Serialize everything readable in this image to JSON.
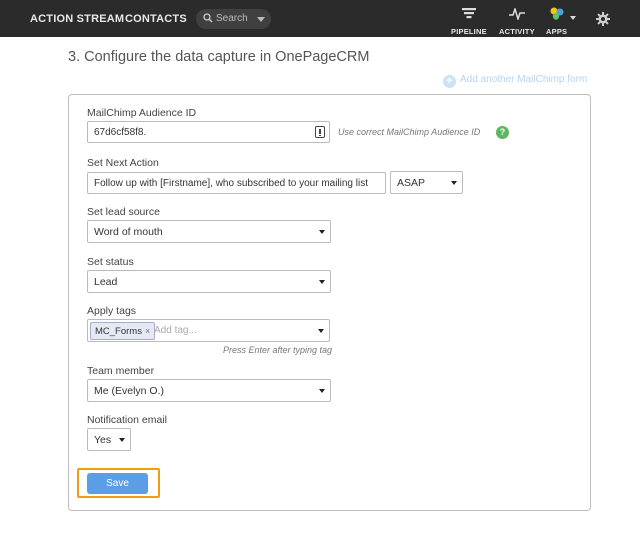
{
  "nav": {
    "action_stream": "ACTION STREAM",
    "contacts": "CONTACTS",
    "search_placeholder": "Search",
    "pipeline": "PIPELINE",
    "activity": "ACTIVITY",
    "apps": "APPS"
  },
  "page": {
    "heading": "3. Configure the data capture in OnePageCRM",
    "add_form_link": "Add another MailChimp form"
  },
  "form": {
    "audience_id": {
      "label": "MailChimp Audience ID",
      "value": "67d6cf58f8.",
      "hint": "Use correct MailChimp Audience ID"
    },
    "next_action": {
      "label": "Set Next Action",
      "value": "Follow up with [Firstname], who subscribed to your mailing list",
      "timing": "ASAP"
    },
    "lead_source": {
      "label": "Set lead source",
      "value": "Word of mouth"
    },
    "status": {
      "label": "Set status",
      "value": "Lead"
    },
    "tags": {
      "label": "Apply tags",
      "chip": "MC_Forms",
      "placeholder": "Add tag...",
      "hint": "Press Enter after typing tag"
    },
    "team_member": {
      "label": "Team member",
      "value": "Me (Evelyn O.)"
    },
    "notification": {
      "label": "Notification email",
      "value": "Yes"
    },
    "save_label": "Save"
  },
  "colors": {
    "topbar": "#2b2b2b",
    "save_button": "#5c9ee6",
    "highlight": "#f39c12",
    "help": "#5cb85c"
  }
}
